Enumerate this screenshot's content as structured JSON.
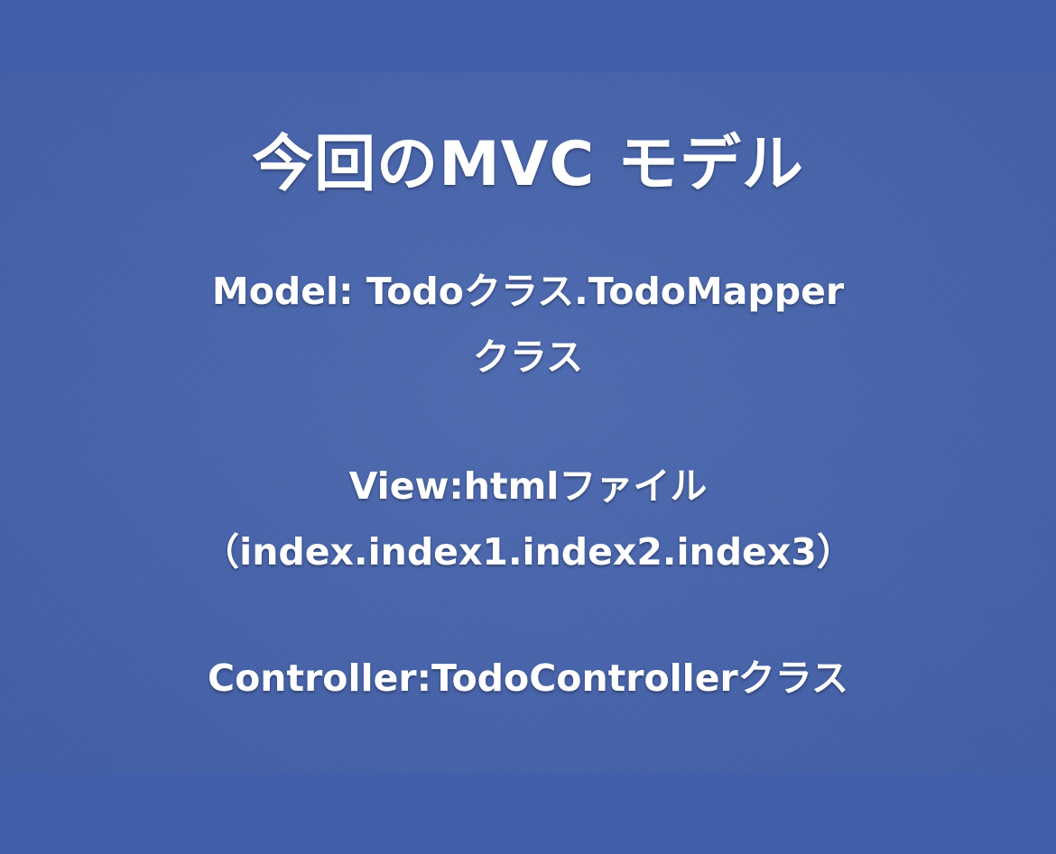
{
  "slide": {
    "title": "今回のMVC モデル",
    "model_line1": "Model: Todoクラス.TodoMapper",
    "model_line2": "クラス",
    "view_line1": "View:htmlファイル",
    "view_line2": "（index.index1.index2.index3）",
    "controller_line": "Controller:TodoControllerクラス"
  },
  "colors": {
    "background": "#4060ab",
    "text": "#ffffff"
  }
}
